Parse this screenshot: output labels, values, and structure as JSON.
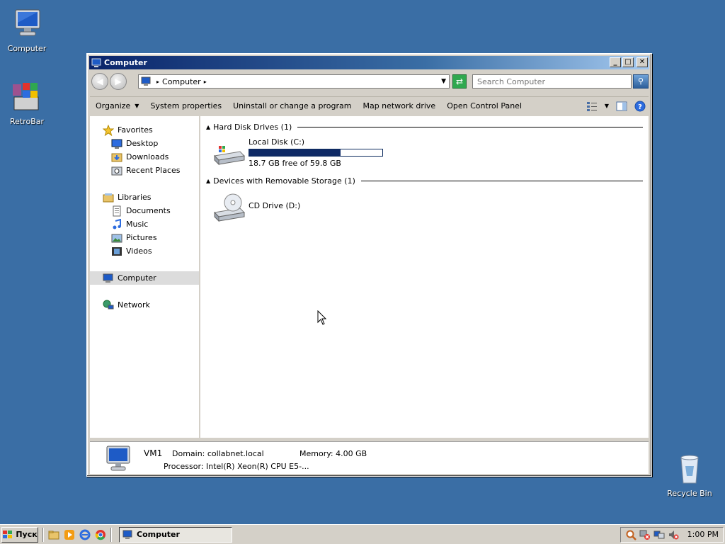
{
  "desktop": {
    "icons": [
      {
        "label": "Computer"
      },
      {
        "label": "RetroBar"
      },
      {
        "label": "Recycle Bin"
      }
    ]
  },
  "window": {
    "title": "Computer",
    "controls": {
      "minimize": "_",
      "maximize": "□",
      "close": "✕"
    },
    "address": {
      "path": "Computer"
    },
    "search": {
      "placeholder": "Search Computer"
    },
    "commands": [
      "Organize",
      "System properties",
      "Uninstall or change a program",
      "Map network drive",
      "Open Control Panel"
    ],
    "nav": {
      "favorites": "Favorites",
      "favorites_items": [
        "Desktop",
        "Downloads",
        "Recent Places"
      ],
      "libraries": "Libraries",
      "libraries_items": [
        "Documents",
        "Music",
        "Pictures",
        "Videos"
      ],
      "computer": "Computer",
      "network": "Network"
    },
    "groups": [
      {
        "title": "Hard Disk Drives (1)"
      },
      {
        "title": "Devices with Removable Storage (1)"
      }
    ],
    "drives": {
      "c": {
        "name": "Local Disk (C:)",
        "free_text": "18.7 GB free of 59.8 GB",
        "used_fraction": 0.687
      },
      "d": {
        "name": "CD Drive (D:)"
      }
    },
    "details": {
      "name": "VM1",
      "domain": "Domain: collabnet.local",
      "memory": "Memory: 4.00 GB",
      "processor": "Processor: Intel(R) Xeon(R) CPU E5-..."
    }
  },
  "taskbar": {
    "start_label": "Пуск",
    "task_label": "Computer",
    "clock": "1:00 PM"
  },
  "colors": {
    "desktop": "#3a6ea5",
    "titlebar_start": "#0a246a",
    "bar_fill": "#0f2a66",
    "chrome": "#d4d0c8"
  }
}
